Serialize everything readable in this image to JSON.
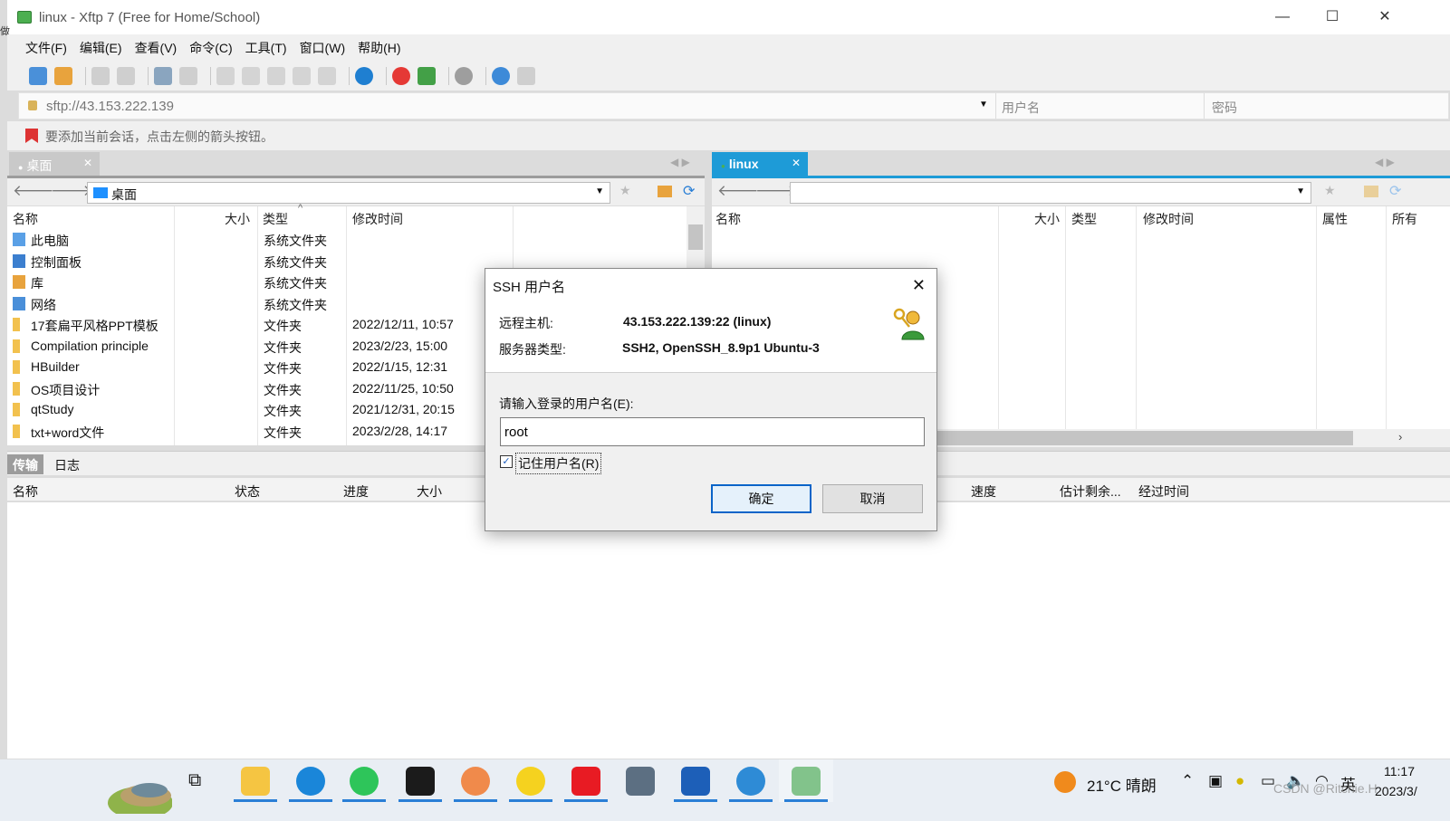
{
  "window": {
    "title": "linux - Xftp 7 (Free for Home/School)",
    "side_char": "做"
  },
  "menu": [
    "文件(F)",
    "编辑(E)",
    "查看(V)",
    "命令(C)",
    "工具(T)",
    "窗口(W)",
    "帮助(H)"
  ],
  "address": {
    "url": "sftp://43.153.222.139",
    "user_placeholder": "用户名",
    "password_placeholder": "密码"
  },
  "hint": "要添加当前会话，点击左侧的箭头按钮。",
  "left_pane": {
    "tab": "桌面",
    "path": "桌面",
    "columns": [
      "名称",
      "大小",
      "类型",
      "修改时间"
    ],
    "rows": [
      {
        "name": "此电脑",
        "type": "系统文件夹",
        "modified": ""
      },
      {
        "name": "控制面板",
        "type": "系统文件夹",
        "modified": ""
      },
      {
        "name": "库",
        "type": "系统文件夹",
        "modified": ""
      },
      {
        "name": "网络",
        "type": "系统文件夹",
        "modified": ""
      },
      {
        "name": "17套扁平风格PPT模板",
        "type": "文件夹",
        "modified": "2022/12/11, 10:57"
      },
      {
        "name": "Compilation principle",
        "type": "文件夹",
        "modified": "2023/2/23, 15:00"
      },
      {
        "name": "HBuilder",
        "type": "文件夹",
        "modified": "2022/1/15, 12:31"
      },
      {
        "name": "OS项目设计",
        "type": "文件夹",
        "modified": "2022/11/25, 10:50"
      },
      {
        "name": "qtStudy",
        "type": "文件夹",
        "modified": "2021/12/31, 20:15"
      },
      {
        "name": "txt+word文件",
        "type": "文件夹",
        "modified": "2023/2/28, 14:17"
      }
    ]
  },
  "right_pane": {
    "tab": "linux",
    "path": "",
    "columns": [
      "名称",
      "大小",
      "类型",
      "修改时间",
      "属性",
      "所有"
    ]
  },
  "transfer": {
    "tabs": [
      "传输",
      "日志"
    ],
    "columns": [
      "名称",
      "状态",
      "进度",
      "大小",
      "速度",
      "估计剩余...",
      "经过时间"
    ]
  },
  "dialog": {
    "title": "SSH 用户名",
    "remote_host_label": "远程主机:",
    "remote_host": "43.153.222.139:22 (linux)",
    "server_type_label": "服务器类型:",
    "server_type": "SSH2, OpenSSH_8.9p1 Ubuntu-3",
    "prompt": "请输入登录的用户名(E):",
    "username": "root",
    "remember_label": "记住用户名(R)",
    "remember_checked": true,
    "ok": "确定",
    "cancel": "取消"
  },
  "taskbar": {
    "weather": "21°C  晴朗",
    "ime": "英",
    "time": "11:17",
    "date": "2023/3/",
    "watermark": "CSDN @Ritchie.H"
  },
  "colors": {
    "accent": "#1e9bd7",
    "ok_border": "#0a64c8"
  }
}
